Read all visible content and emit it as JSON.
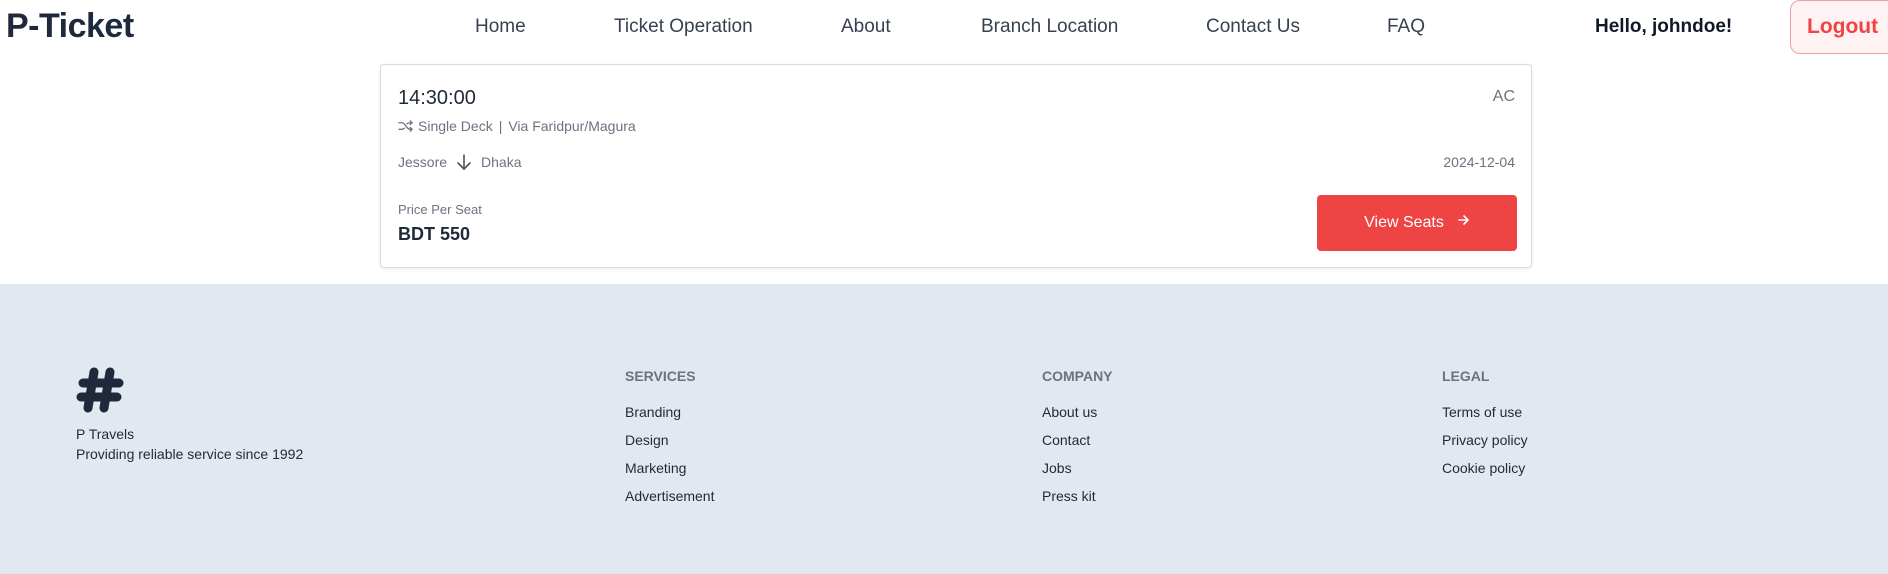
{
  "header": {
    "logo": "P-Ticket",
    "nav": [
      "Home",
      "Ticket Operation",
      "About",
      "Branch Location",
      "Contact Us",
      "FAQ"
    ],
    "greeting": "Hello, johndoe!",
    "logout_label": "Logout"
  },
  "ticket": {
    "time": "14:30:00",
    "class": "AC",
    "deck": "Single Deck",
    "separator": "|",
    "via": "Via Faridpur/Magura",
    "from": "Jessore",
    "to": "Dhaka",
    "date": "2024-12-04",
    "price_label": "Price Per Seat",
    "price": "BDT 550",
    "view_seats_label": "View Seats"
  },
  "footer": {
    "brand_name": "P Travels",
    "tagline": "Providing reliable service since 1992",
    "columns": [
      {
        "title": "Services",
        "links": [
          "Branding",
          "Design",
          "Marketing",
          "Advertisement"
        ]
      },
      {
        "title": "Company",
        "links": [
          "About us",
          "Contact",
          "Jobs",
          "Press kit"
        ]
      },
      {
        "title": "Legal",
        "links": [
          "Terms of use",
          "Privacy policy",
          "Cookie policy"
        ]
      }
    ]
  },
  "icons": {
    "brand": "hashtag-icon",
    "deck": "shuffle-icon",
    "route": "arrow-down-icon",
    "view_seats": "arrow-right-icon"
  },
  "colors": {
    "accent": "#ef4444",
    "footer_bg": "#e2e8f0",
    "logout_bg": "#fef2f2"
  }
}
